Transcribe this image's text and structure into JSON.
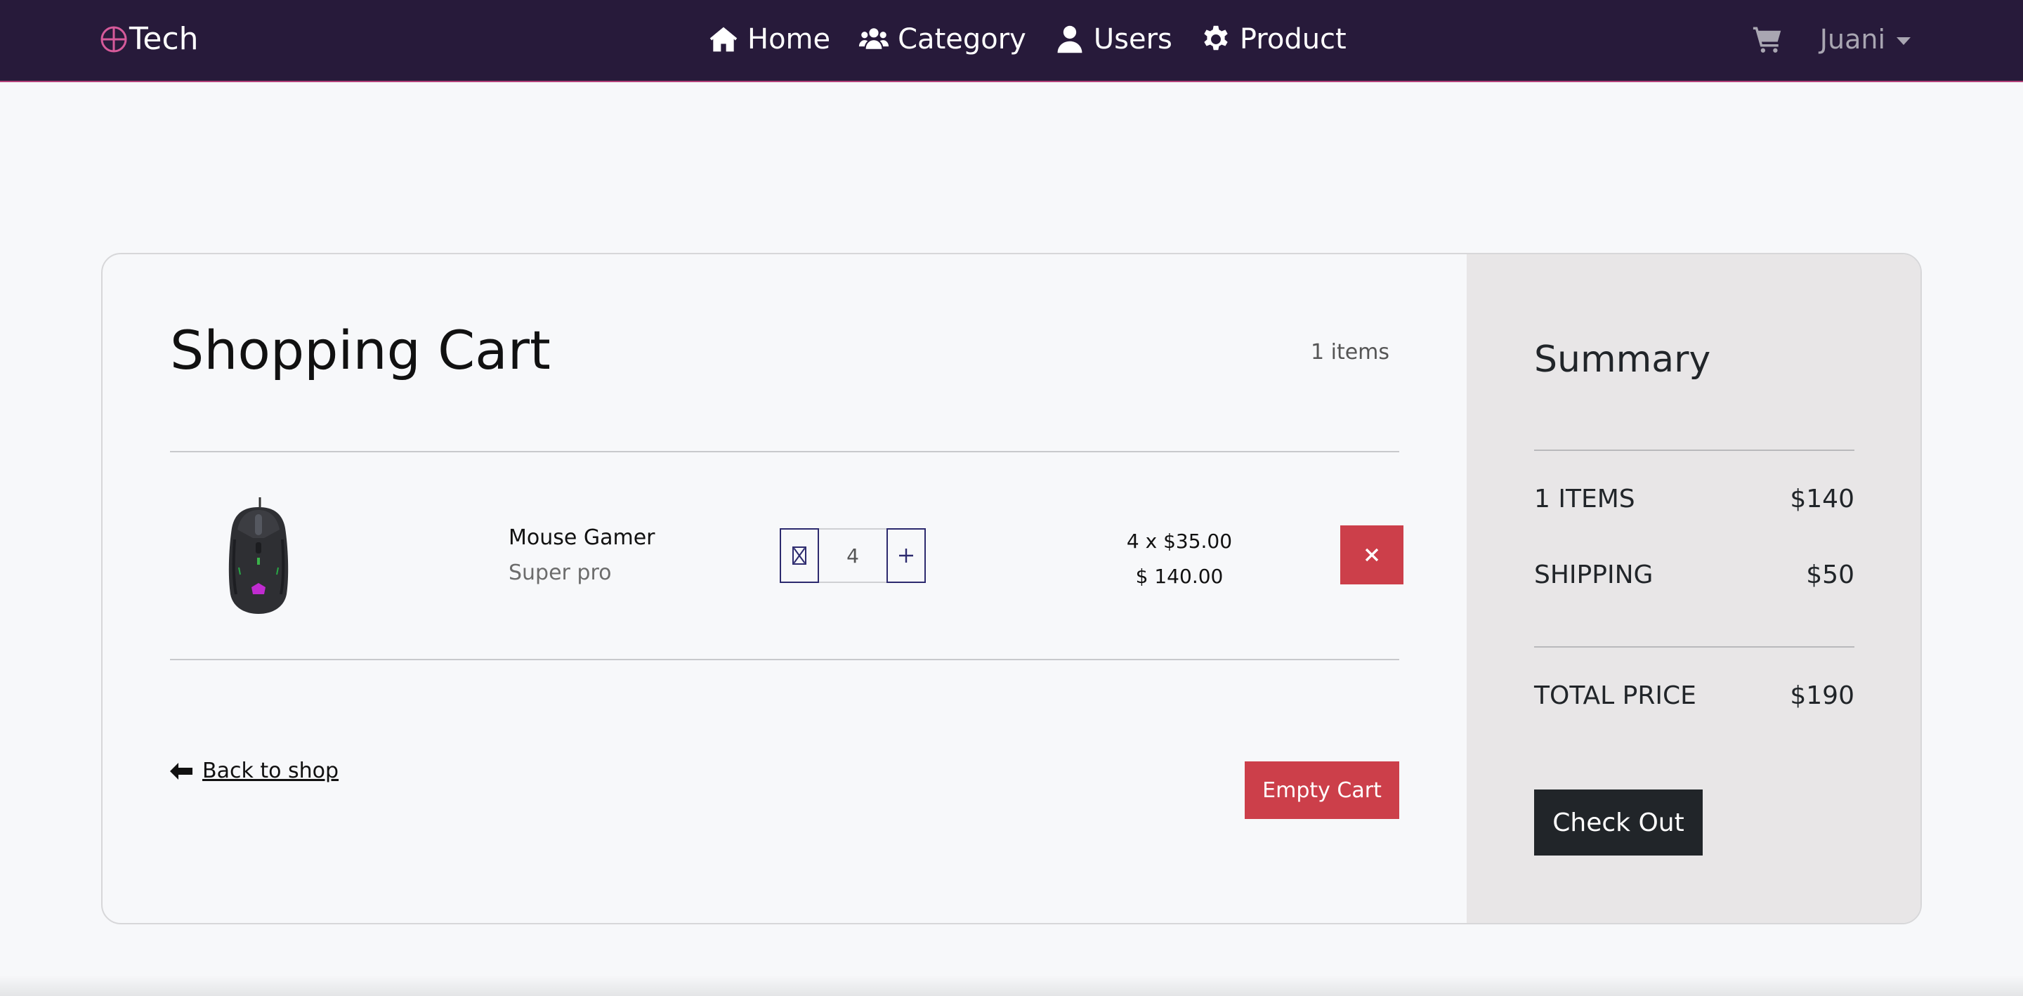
{
  "navbar": {
    "brand": "Tech",
    "links": [
      {
        "label": "Home",
        "icon": "home-icon"
      },
      {
        "label": "Category",
        "icon": "users-group-icon"
      },
      {
        "label": "Users",
        "icon": "user-icon"
      },
      {
        "label": "Product",
        "icon": "gear-icon"
      }
    ],
    "user_name": "Juani",
    "colors": {
      "background": "#271a3a",
      "accent": "#b5427a"
    }
  },
  "cart": {
    "title": "Shopping Cart",
    "items_count": "1 items",
    "items": [
      {
        "name": "Mouse Gamer",
        "description": "Super pro",
        "quantity": "4",
        "unit_price_line": "4 x $35.00",
        "total_line": "$ 140.00"
      }
    ],
    "back_label": "Back to shop",
    "empty_label": "Empty Cart",
    "colors": {
      "danger": "#cc3f4a",
      "qty_border": "#2c2a6e"
    }
  },
  "summary": {
    "title": "Summary",
    "items_label": "1 ITEMS",
    "items_value": "$140",
    "shipping_label": "SHIPPING",
    "shipping_value": "$50",
    "total_label": "TOTAL PRICE",
    "total_value": "$190",
    "checkout_label": "Check Out"
  }
}
